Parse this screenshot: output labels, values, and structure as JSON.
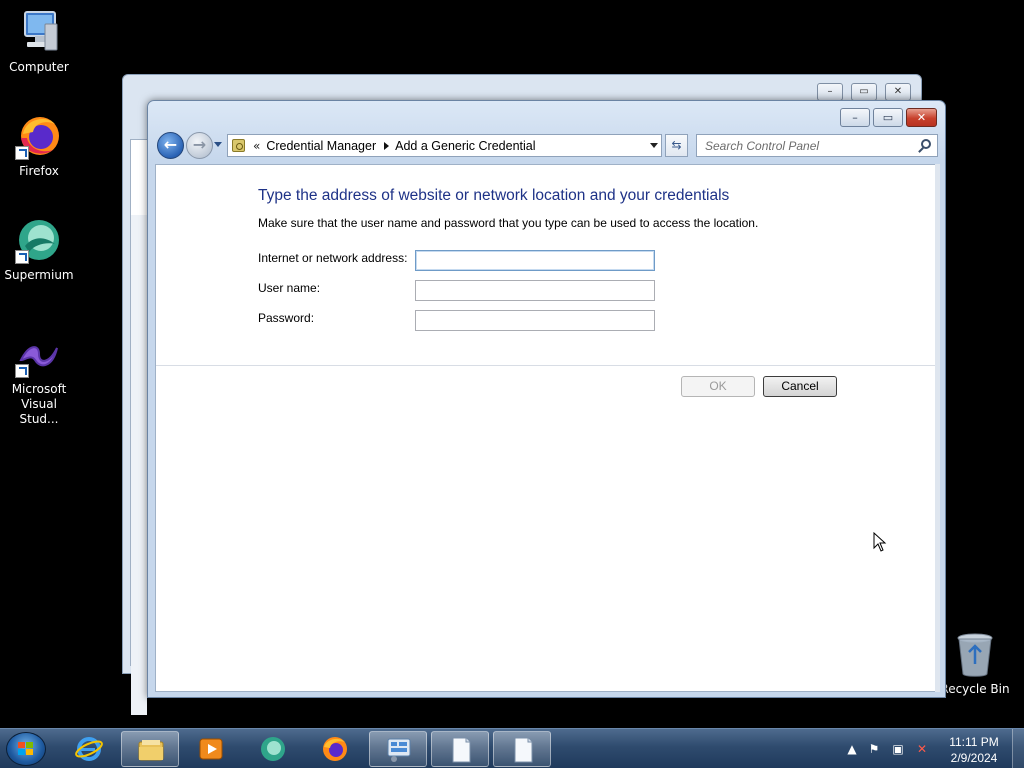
{
  "desktop": {
    "icons": [
      {
        "label": "Computer"
      },
      {
        "label": "Firefox"
      },
      {
        "label": "Supermium"
      },
      {
        "label": "Microsoft Visual Stud..."
      },
      {
        "label": "Recycle Bin"
      }
    ]
  },
  "window": {
    "controls": {
      "minimize": "–",
      "maximize": "▭",
      "close": "✕"
    },
    "address": {
      "chevron": "«",
      "crumbs": [
        "Credential Manager",
        "Add a Generic Credential"
      ]
    },
    "search": {
      "placeholder": "Search Control Panel"
    },
    "form": {
      "heading": "Type the address of website or network location and your credentials",
      "subtext": "Make sure that the user name and password that you type can be used to access the location.",
      "fields": [
        {
          "label": "Internet or network address:",
          "value": ""
        },
        {
          "label": "User name:",
          "value": ""
        },
        {
          "label": "Password:",
          "value": ""
        }
      ],
      "ok_label": "OK",
      "cancel_label": "Cancel"
    }
  },
  "taskbar": {
    "clock": {
      "time": "11:11 PM",
      "date": "2/9/2024"
    },
    "pinned": [
      "start-button",
      "internet-explorer",
      "file-explorer",
      "media-player",
      "supermium",
      "firefox",
      "control-panel",
      "notepad-window-1",
      "notepad-window-2"
    ]
  },
  "colors": {
    "heading": "#1e3287",
    "taskbar": "#2f4b6e",
    "close_button": "#c7402c"
  }
}
